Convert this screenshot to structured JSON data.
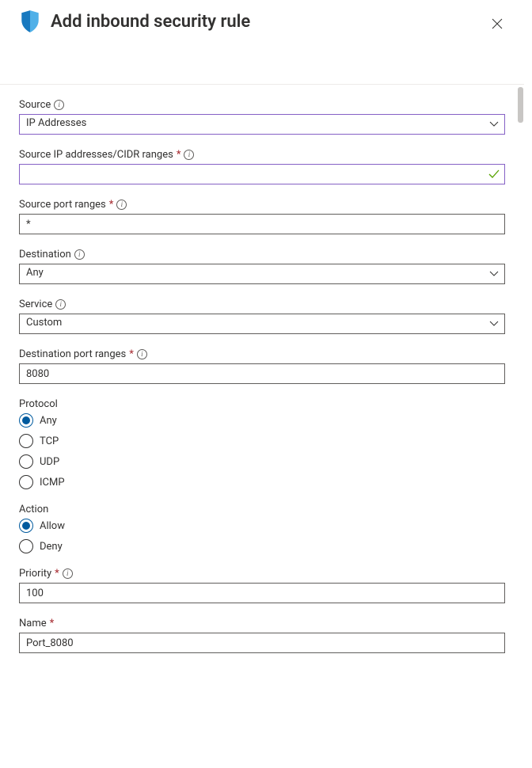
{
  "header": {
    "title": "Add inbound security rule"
  },
  "fields": {
    "source": {
      "label": "Source",
      "value": "IP Addresses"
    },
    "source_ip": {
      "label": "Source IP addresses/CIDR ranges",
      "value": ""
    },
    "source_port": {
      "label": "Source port ranges",
      "value": "*"
    },
    "destination": {
      "label": "Destination",
      "value": "Any"
    },
    "service": {
      "label": "Service",
      "value": "Custom"
    },
    "dest_port": {
      "label": "Destination port ranges",
      "value": "8080"
    },
    "protocol": {
      "label": "Protocol",
      "options": [
        "Any",
        "TCP",
        "UDP",
        "ICMP"
      ],
      "selected": "Any"
    },
    "action": {
      "label": "Action",
      "options": [
        "Allow",
        "Deny"
      ],
      "selected": "Allow"
    },
    "priority": {
      "label": "Priority",
      "value": "100"
    },
    "name": {
      "label": "Name",
      "value": "Port_8080"
    }
  }
}
